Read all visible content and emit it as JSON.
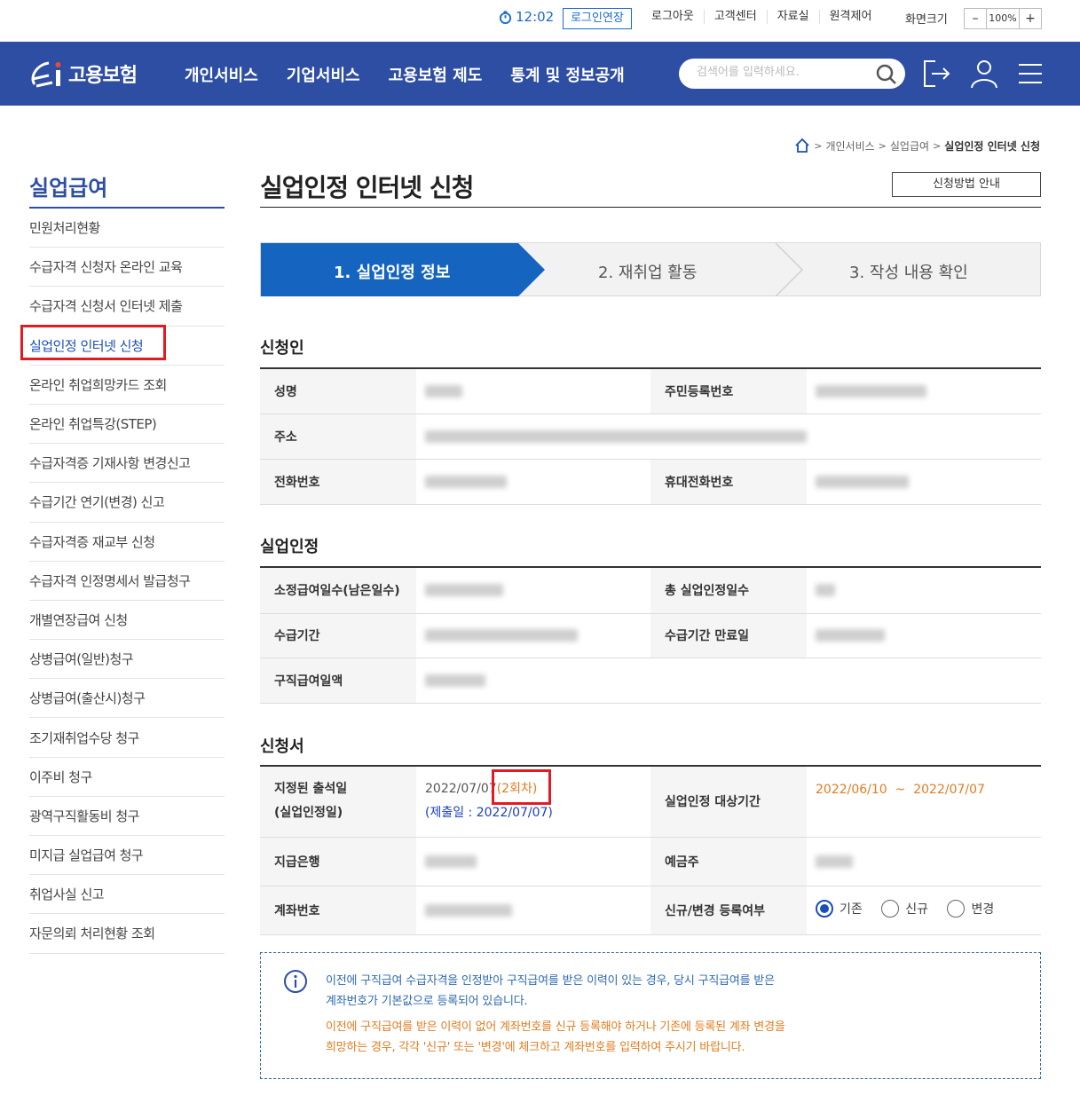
{
  "util": {
    "timer": "12:02",
    "extend_label": "로그인연장",
    "links": [
      "로그아웃",
      "고객센터",
      "자료실",
      "원격제어"
    ],
    "zoom_label": "화면크기",
    "zoom_minus": "–",
    "zoom_value": "100%",
    "zoom_plus": "+"
  },
  "header": {
    "logo_text": "고용보험",
    "nav": [
      "개인서비스",
      "기업서비스",
      "고용보험 제도",
      "통계 및 정보공개"
    ],
    "search_placeholder": "검색어를 입력하세요."
  },
  "breadcrumb": {
    "items": [
      "개인서비스",
      "실업급여"
    ],
    "current": "실업인정 인터넷 신청"
  },
  "sidebar": {
    "title": "실업급여",
    "items": [
      "민원처리현황",
      "수급자격 신청자 온라인 교육",
      "수급자격 신청서 인터넷 제출",
      "실업인정 인터넷 신청",
      "온라인 취업희망카드 조회",
      "온라인 취업특강(STEP)",
      "수급자격증 기재사항 변경신고",
      "수급기간 연기(변경) 신고",
      "수급자격증 재교부 신청",
      "수급자격 인정명세서 발급청구",
      "개별연장급여 신청",
      "상병급여(일반)청구",
      "상병급여(출산시)청구",
      "조기재취업수당 청구",
      "이주비 청구",
      "광역구직활동비 청구",
      "미지급 실업급여 청구",
      "취업사실 신고",
      "자문의뢰 처리현황 조회"
    ],
    "active_index": 3
  },
  "page": {
    "title": "실업인정 인터넷 신청",
    "guide_button": "신청방법 안내"
  },
  "steps": [
    "1. 실업인정 정보",
    "2. 재취업 활동",
    "3. 작성 내용 확인"
  ],
  "applicant": {
    "title": "신청인",
    "name_label": "성명",
    "rrn_label": "주민등록번호",
    "address_label": "주소",
    "phone_label": "전화번호",
    "mobile_label": "휴대전화번호"
  },
  "recognition": {
    "title": "실업인정",
    "days_label": "소정급여일수(남은일수)",
    "total_label": "총 실업인정일수",
    "period_label": "수급기간",
    "expire_label": "수급기간 만료일",
    "daily_label": "구직급여일액"
  },
  "application": {
    "title": "신청서",
    "attend_label_1": "지정된 출석일",
    "attend_label_2": "(실업인정일)",
    "attend_date": "2022/07/07",
    "attend_round": "(2회차)",
    "submit_date": "(제출일 : 2022/07/07)",
    "target_label": "실업인정 대상기간",
    "target_period": "2022/06/10  ~  2022/07/07",
    "bank_label": "지급은행",
    "holder_label": "예금주",
    "account_label": "계좌번호",
    "reg_label": "신규/변경 등록여부",
    "reg_options": [
      "기존",
      "신규",
      "변경"
    ],
    "reg_selected": 0
  },
  "notice": {
    "line1": "이전에 구직급여 수급자격을 인정받아 구직급여를 받은 이력이 있는 경우, 당시 구직급여를 받은",
    "line2": "계좌번호가 기본값으로 등록되어 있습니다.",
    "line3": "이전에 구직급여를 받은 이력이 없어 계좌번호를 신규 등록해야 하거나 기존에 등록된 계좌 변경을",
    "line4": "희망하는 경우, 각각 '신규' 또는 '변경'에 체크하고 계좌번호를 입력하여 주시기 바랍니다."
  },
  "colors": {
    "brand": "#2d4ea3",
    "step_active": "#1565c0",
    "orange": "#e17c1f",
    "highlight": "#e21b23"
  }
}
